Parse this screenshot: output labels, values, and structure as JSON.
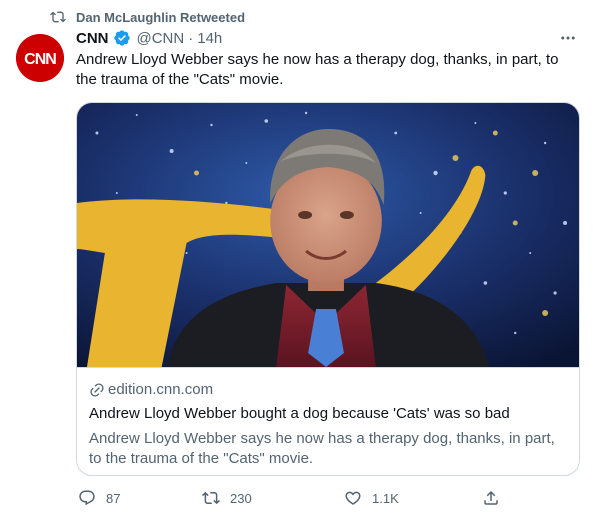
{
  "retweet": {
    "text": "Dan McLaughlin Retweeted",
    "icon": "retweet-icon"
  },
  "author": {
    "avatar_text": "CNN",
    "display_name": "CNN",
    "handle": "@CNN",
    "separator": "·",
    "timestamp": "14h",
    "verified_icon": "verified-badge-icon",
    "avatar_color": "#cc0000"
  },
  "tweet": {
    "text": "Andrew Lloyd Webber says he now has a therapy dog, thanks, in part, to the trauma of the \"Cats\" movie."
  },
  "card": {
    "domain": "edition.cnn.com",
    "title": "Andrew Lloyd Webber bought a dog because 'Cats' was so bad",
    "description": "Andrew Lloyd Webber says he now has a therapy dog, thanks, in part, to the trauma of the \"Cats\" movie."
  },
  "actions": {
    "reply": {
      "icon": "reply-icon",
      "count": "87"
    },
    "retweet": {
      "icon": "retweet-icon",
      "count": "230"
    },
    "like": {
      "icon": "heart-icon",
      "count": "1.1K"
    },
    "share": {
      "icon": "share-icon"
    }
  },
  "colors": {
    "text_primary": "#0f1419",
    "text_secondary": "#536471",
    "border": "#cfd9de",
    "verified_blue": "#1d9bf0"
  }
}
